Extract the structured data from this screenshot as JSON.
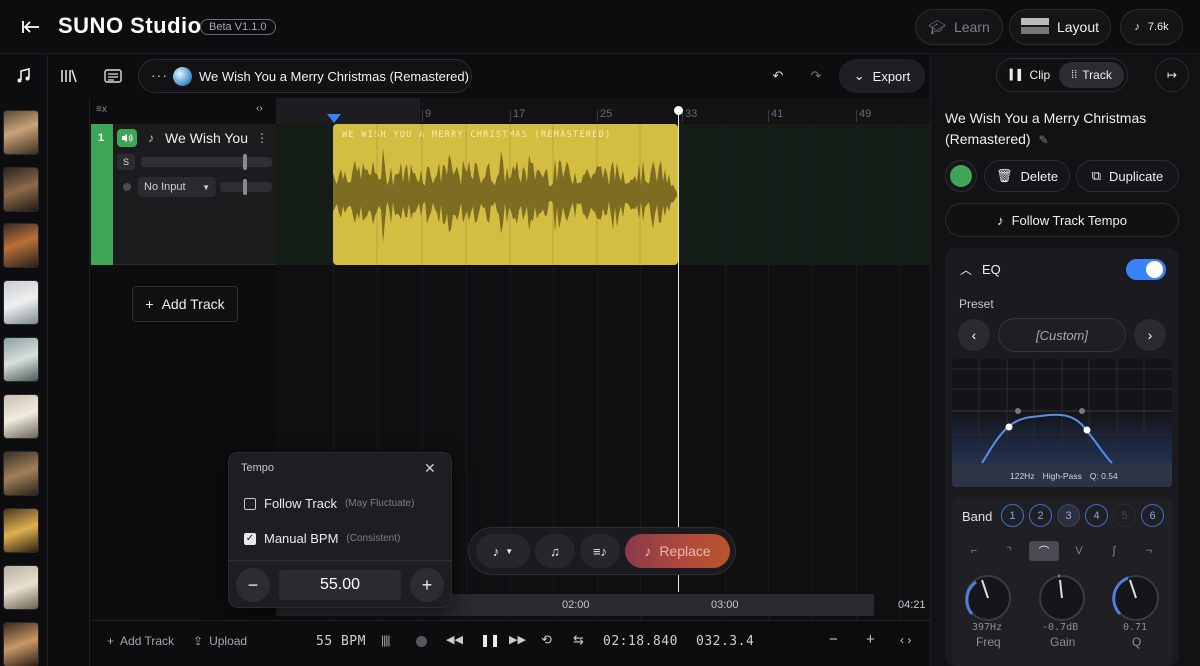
{
  "app": {
    "brand": "SUNO Studio",
    "version_badge": "Beta V1.1.0"
  },
  "topbar": {
    "learn_label": "Learn",
    "layout_label": "Layout",
    "credits": "7.6k"
  },
  "song": {
    "title": "We Wish You a Merry Christmas (Remastered)"
  },
  "toolbar": {
    "export_label": "Export"
  },
  "track": {
    "number": "1",
    "name": "We Wish You a Merry Christmas",
    "solo_label": "S",
    "input_label": "No Input",
    "clip_title": "WE WISH YOU A MERRY CHRISTMAS (REMASTERED)",
    "color": "#3fa557",
    "clip_color": "#d4be41"
  },
  "add_track_label": "Add Track",
  "ruler": {
    "labels": [
      "9",
      "17",
      "25",
      "33",
      "41",
      "49"
    ]
  },
  "scrubber": {
    "labels": [
      "02:00",
      "03:00",
      "04:21"
    ]
  },
  "tempo_popup": {
    "title": "Tempo",
    "follow_label": "Follow Track",
    "follow_hint": "(May Fluctuate)",
    "manual_label": "Manual BPM",
    "manual_hint": "(Consistent)",
    "bpm_value": "55.00",
    "follow_checked": false,
    "manual_checked": true
  },
  "mini_bar": {
    "replace_label": "Replace"
  },
  "transport": {
    "add_track_label": "Add Track",
    "upload_label": "Upload",
    "bpm": "55 BPM",
    "time": "02:18.840",
    "bar_position": "032.3.4"
  },
  "right_panel": {
    "clip_tab": "Clip",
    "track_tab": "Track",
    "title": "We Wish You a Merry Christmas (Remastered)",
    "delete_label": "Delete",
    "duplicate_label": "Duplicate",
    "follow_tempo_label": "Follow Track Tempo",
    "eq": {
      "label": "EQ",
      "enabled": true,
      "preset_label": "Preset",
      "preset_value": "[Custom]",
      "readout": [
        "122Hz",
        "High-Pass",
        "Q: 0.54"
      ],
      "band_label": "Band",
      "bands": [
        "1",
        "2",
        "3",
        "4",
        "5",
        "6"
      ],
      "knobs": [
        {
          "value": "397Hz",
          "label": "Freq"
        },
        {
          "value": "-0.7dB",
          "label": "Gain"
        },
        {
          "value": "0.71",
          "label": "Q"
        }
      ]
    }
  },
  "colors": {
    "accent": "#3b82f6",
    "track_green": "#3fa557",
    "clip_yellow": "#d4be41"
  }
}
